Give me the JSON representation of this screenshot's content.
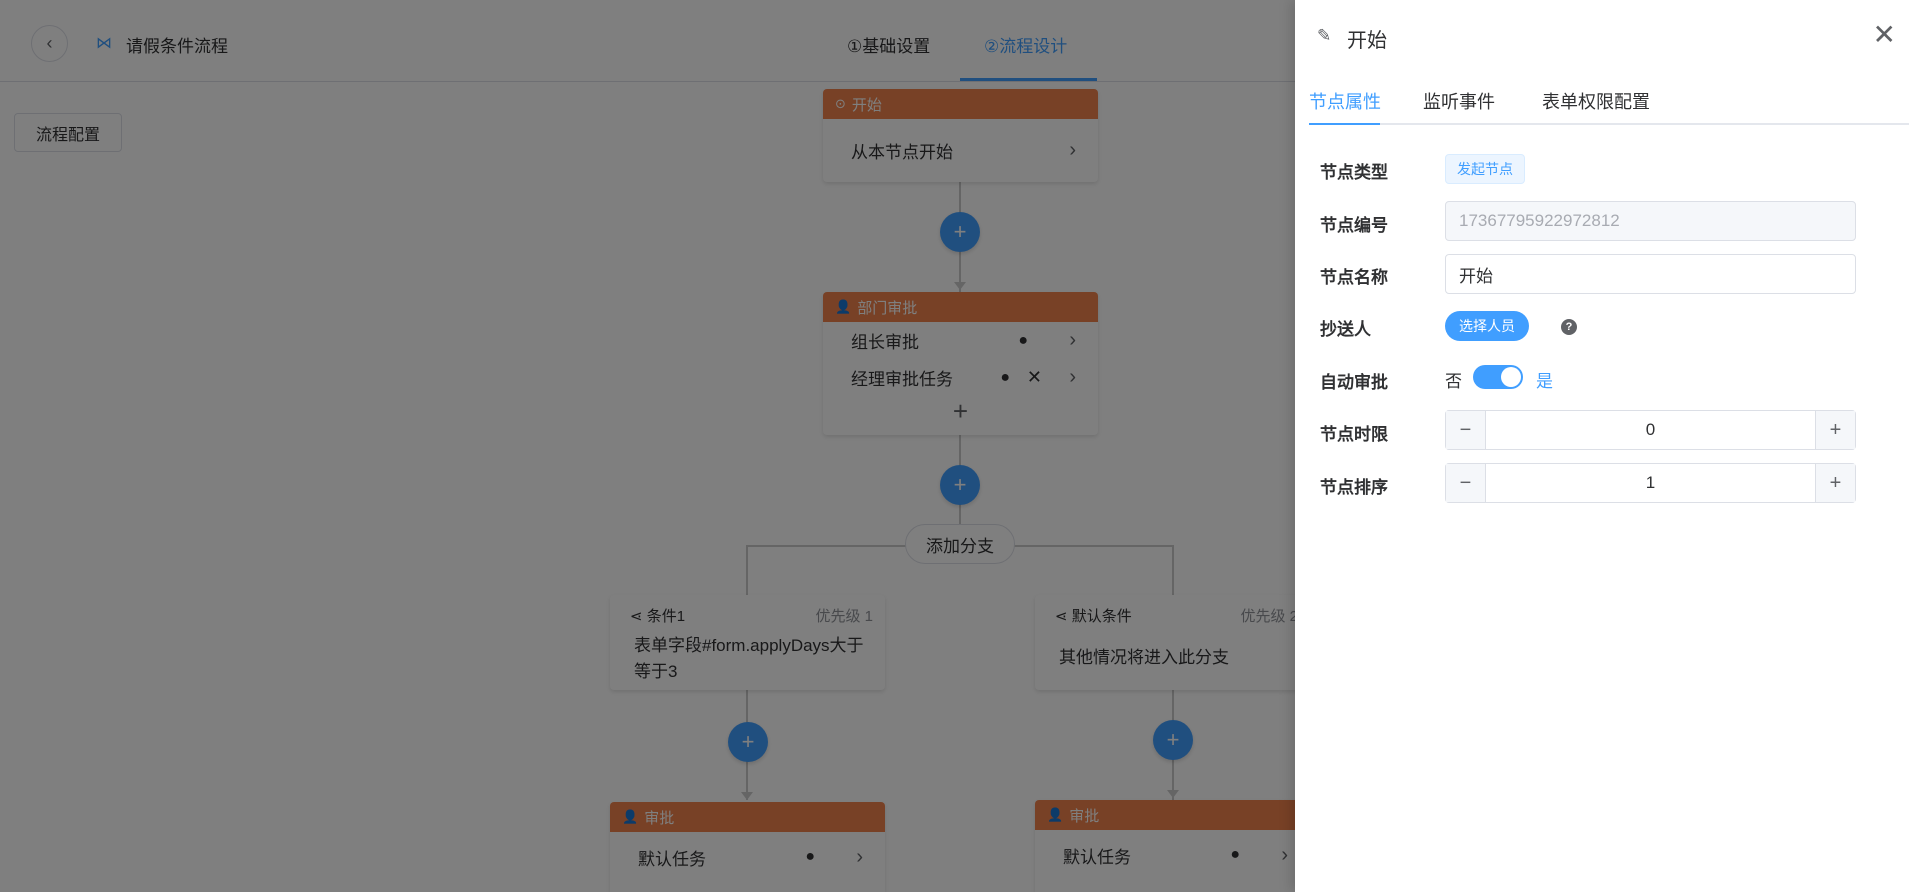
{
  "header": {
    "title": "请假条件流程",
    "steps": [
      "①基础设置",
      "②流程设计"
    ],
    "active_step": 1
  },
  "toolbar": {
    "config_label": "流程配置"
  },
  "flow": {
    "start_node": {
      "title": "开始",
      "content": "从本节点开始"
    },
    "dept_node": {
      "title": "部门审批",
      "tasks": [
        "组长审批",
        "经理审批任务"
      ]
    },
    "add_branch_label": "添加分支",
    "branches": [
      {
        "title": "条件1",
        "priority": "优先级 1",
        "content": "表单字段#form.applyDays大于等于3",
        "approval": {
          "title": "审批",
          "task": "默认任务"
        }
      },
      {
        "title": "默认条件",
        "priority": "优先级 2",
        "content": "其他情况将进入此分支",
        "approval": {
          "title": "审批",
          "task": "默认任务"
        }
      }
    ]
  },
  "drawer": {
    "title": "开始",
    "tabs": [
      "节点属性",
      "监听事件",
      "表单权限配置"
    ],
    "active_tab": 0,
    "fields": {
      "node_type": {
        "label": "节点类型",
        "value": "发起节点"
      },
      "node_id": {
        "label": "节点编号",
        "value": "17367795922972812"
      },
      "node_name": {
        "label": "节点名称",
        "value": "开始"
      },
      "cc": {
        "label": "抄送人",
        "button": "选择人员"
      },
      "auto_approve": {
        "label": "自动审批",
        "off_text": "否",
        "on_text": "是",
        "enabled": true
      },
      "time_limit": {
        "label": "节点时限",
        "value": "0"
      },
      "sort": {
        "label": "节点排序",
        "value": "1"
      }
    }
  },
  "colors": {
    "accent": "#409eff",
    "node_header": "#f0834c",
    "overlay": "rgba(0,0,0,0.5)"
  }
}
